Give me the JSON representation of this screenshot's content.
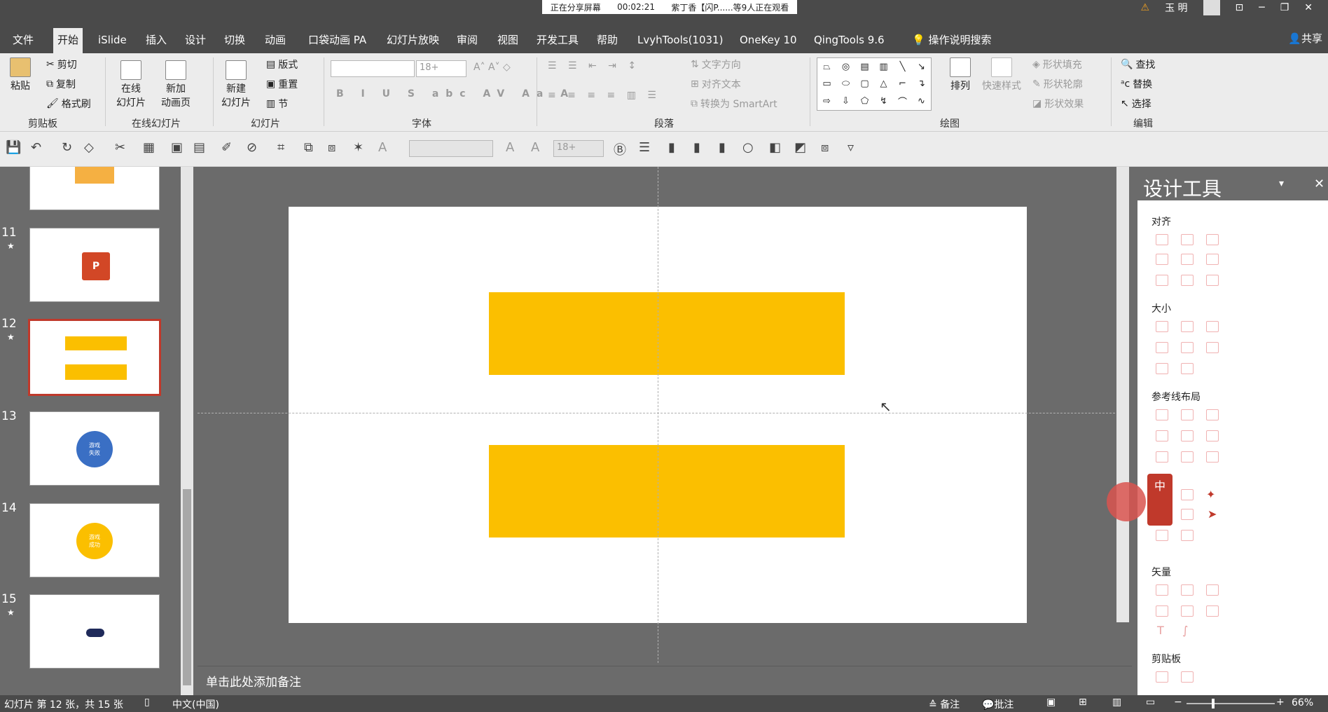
{
  "sharing": {
    "status": "正在分享屏幕",
    "timer": "00:02:21",
    "viewers": "紫丁香【闪P......等9人正在观看"
  },
  "window": {
    "user": "玉 明",
    "warn_icon": "warning-icon"
  },
  "tabs": [
    "文件",
    "开始",
    "iSlide",
    "插入",
    "设计",
    "切换",
    "动画",
    "口袋动画 PA",
    "幻灯片放映",
    "审阅",
    "视图",
    "开发工具",
    "帮助",
    "LvyhTools(1031)",
    "OneKey 10",
    "QingTools 9.6",
    "操作说明搜索"
  ],
  "share_label": "共享",
  "ribbon": {
    "clipboard": {
      "paste": "粘贴",
      "cut": "剪切",
      "copy": "复制",
      "format_painter": "格式刷",
      "label": "剪贴板"
    },
    "online": {
      "online_slides": "在线\n幻灯片",
      "new_anim_page": "新加\n动画页",
      "label": "在线幻灯片"
    },
    "slides": {
      "new_slide": "新建\n幻灯片",
      "layout": "版式",
      "reset": "重置",
      "section": "节",
      "label": "幻灯片"
    },
    "font": {
      "size": "18+",
      "label": "字体"
    },
    "paragraph": {
      "text_direction": "文字方向",
      "align_text": "对齐文本",
      "smartart": "转换为 SmartArt",
      "label": "段落"
    },
    "drawing": {
      "arrange": "排列",
      "quick_styles": "快速样式",
      "shape_fill": "形状填充",
      "shape_outline": "形状轮廓",
      "shape_effects": "形状效果",
      "label": "绘图"
    },
    "editing": {
      "find": "查找",
      "replace": "替换",
      "select": "选择",
      "label": "编辑"
    }
  },
  "qat": {
    "font_size": "18+"
  },
  "thumbnails": [
    {
      "num": "11",
      "star": "★"
    },
    {
      "num": "12",
      "star": "★"
    },
    {
      "num": "13",
      "star": "",
      "text": "游戏\n失败"
    },
    {
      "num": "14",
      "star": "",
      "text": "游戏\n成功"
    },
    {
      "num": "15",
      "star": "★"
    }
  ],
  "notes_placeholder": "单击此处添加备注",
  "design_pane": {
    "title": "设计工具",
    "sections": [
      "对齐",
      "大小",
      "参考线布局",
      "矢量",
      "剪贴板"
    ],
    "badge": "中"
  },
  "status": {
    "slide_info": "幻灯片 第 12 张，共 15 张",
    "language": "中文(中国)",
    "notes": "备注",
    "comments": "批注",
    "zoom": "66%"
  },
  "colors": {
    "accent_bar": "#fbbf00",
    "selection": "#c0392b",
    "ribbon_bg": "#ececec",
    "chrome": "#4a4a4a"
  }
}
